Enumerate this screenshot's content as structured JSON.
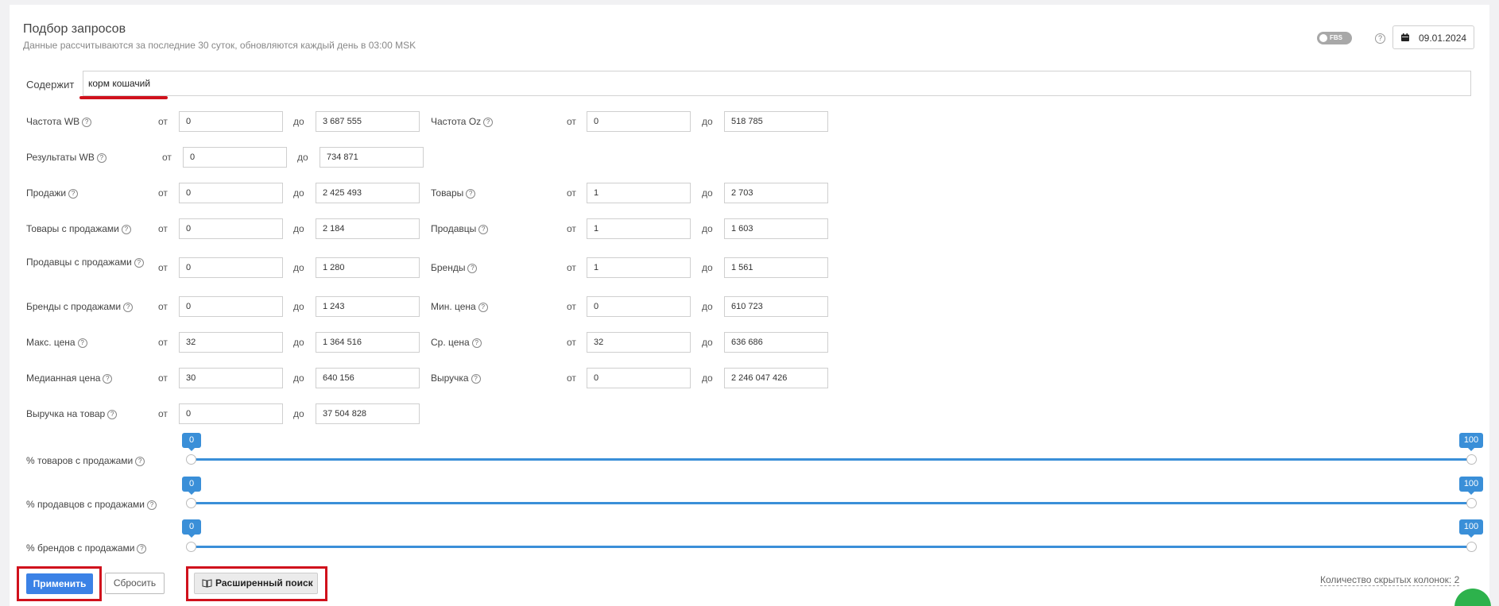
{
  "header": {
    "title": "Подбор запросов",
    "subtitle": "Данные рассчитываются за последние 30 суток, обновляются каждый день в 03:00 MSK",
    "fbs_label": "FBS",
    "help_glyph": "?",
    "date": "09.01.2024"
  },
  "contains": {
    "label": "Содержит",
    "value": "корм кошачий"
  },
  "range_words": {
    "from": "от",
    "to": "до"
  },
  "help_glyph": "?",
  "filters": [
    {
      "label": "Частота WB",
      "from": "0",
      "to": "3 687 555"
    },
    {
      "label": "Частота Oz",
      "from": "0",
      "to": "518 785"
    },
    {
      "label": "Результаты WB",
      "from": "0",
      "to": "734 871"
    },
    {
      "label": "Продажи",
      "from": "0",
      "to": "2 425 493"
    },
    {
      "label": "Товары",
      "from": "1",
      "to": "2 703"
    },
    {
      "label": "Товары с продажами",
      "from": "0",
      "to": "2 184"
    },
    {
      "label": "Продавцы",
      "from": "1",
      "to": "1 603"
    },
    {
      "label": "Продавцы с продажами",
      "from": "0",
      "to": "1 280"
    },
    {
      "label": "Бренды",
      "from": "1",
      "to": "1 561"
    },
    {
      "label": "Бренды с продажами",
      "from": "0",
      "to": "1 243"
    },
    {
      "label": "Мин. цена",
      "from": "0",
      "to": "610 723"
    },
    {
      "label": "Макс. цена",
      "from": "32",
      "to": "1 364 516"
    },
    {
      "label": "Ср. цена",
      "from": "32",
      "to": "636 686"
    },
    {
      "label": "Медианная цена",
      "from": "30",
      "to": "640 156"
    },
    {
      "label": "Выручка",
      "from": "0",
      "to": "2 246 047 426"
    },
    {
      "label": "Выручка на товар",
      "from": "0",
      "to": "37 504 828"
    }
  ],
  "sliders": [
    {
      "label": "% товаров с продажами",
      "min": "0",
      "max": "100"
    },
    {
      "label": "% продавцов с продажами",
      "min": "0",
      "max": "100"
    },
    {
      "label": "% брендов с продажами",
      "min": "0",
      "max": "100"
    }
  ],
  "actions": {
    "apply": "Применить",
    "reset": "Сбросить",
    "advanced": "Расширенный поиск"
  },
  "hidden_columns": "Количество скрытых колонок: 2",
  "colors": {
    "accent": "#3b82e6",
    "slider": "#3a8fd8",
    "highlight": "#d0111c",
    "chat": "#2db24c"
  }
}
